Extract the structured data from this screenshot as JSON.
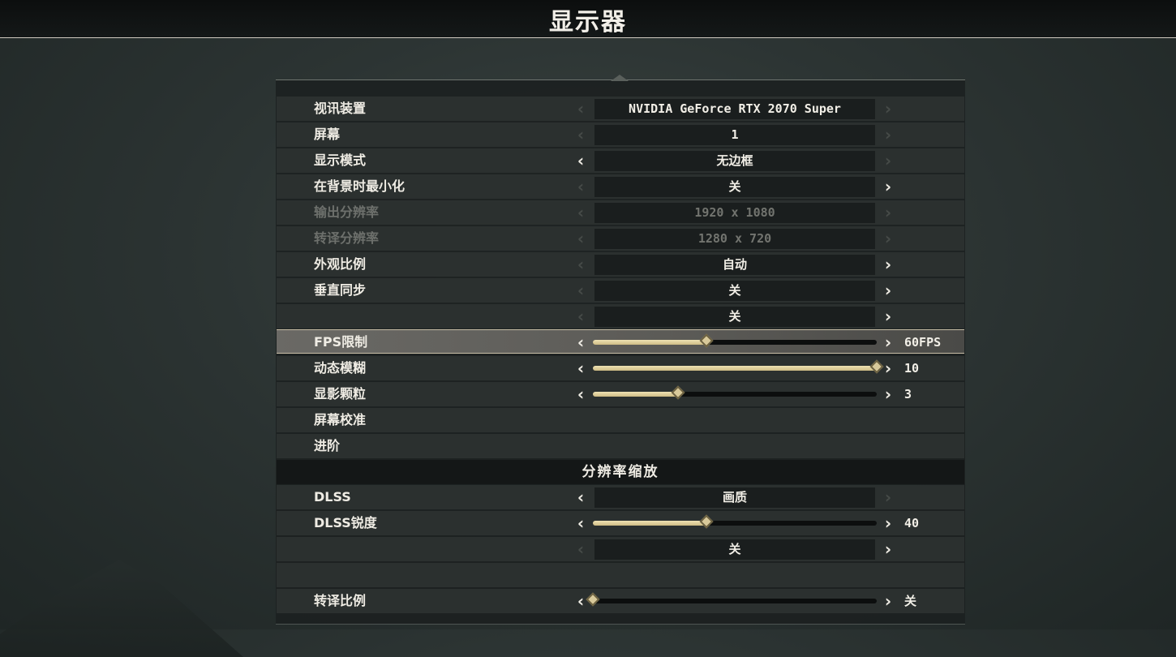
{
  "header": {
    "title": "显示器"
  },
  "settings": {
    "video_device": {
      "label": "视讯装置",
      "value": "NVIDIA GeForce RTX 2070 Super"
    },
    "screen": {
      "label": "屏幕",
      "value": "1"
    },
    "display_mode": {
      "label": "显示模式",
      "value": "无边框"
    },
    "minimize_background": {
      "label": "在背景时最小化",
      "value": "关"
    },
    "output_resolution": {
      "label": "输出分辨率",
      "value": "1920 x 1080"
    },
    "render_resolution": {
      "label": "转译分辨率",
      "value": "1280 x 720"
    },
    "aspect_ratio": {
      "label": "外观比例",
      "value": "自动"
    },
    "vsync": {
      "label": "垂直同步",
      "value": "关"
    },
    "unnamed_toggle": {
      "label": "",
      "value": "关"
    },
    "fps_limit": {
      "label": "FPS限制",
      "value": "60FPS",
      "fill": 0.4
    },
    "motion_blur": {
      "label": "动态模糊",
      "value": "10",
      "fill": 1.0
    },
    "film_grain": {
      "label": "显影颗粒",
      "value": "3",
      "fill": 0.3
    },
    "screen_calibration": {
      "label": "屏幕校准"
    },
    "advanced": {
      "label": "进阶"
    },
    "section_resolution_scaling": {
      "label": "分辨率缩放"
    },
    "dlss": {
      "label": "DLSS",
      "value": "画质"
    },
    "dlss_sharpness": {
      "label": "DLSS锐度",
      "value": "40",
      "fill": 0.4
    },
    "unnamed_toggle_2": {
      "label": "",
      "value": "关"
    },
    "render_scale": {
      "label": "转译比例",
      "value": "关",
      "fill": 0.0
    }
  },
  "colors": {
    "accent": "#d8c99a",
    "selected_row": "#5b5a56",
    "panel": "#1c2121"
  }
}
